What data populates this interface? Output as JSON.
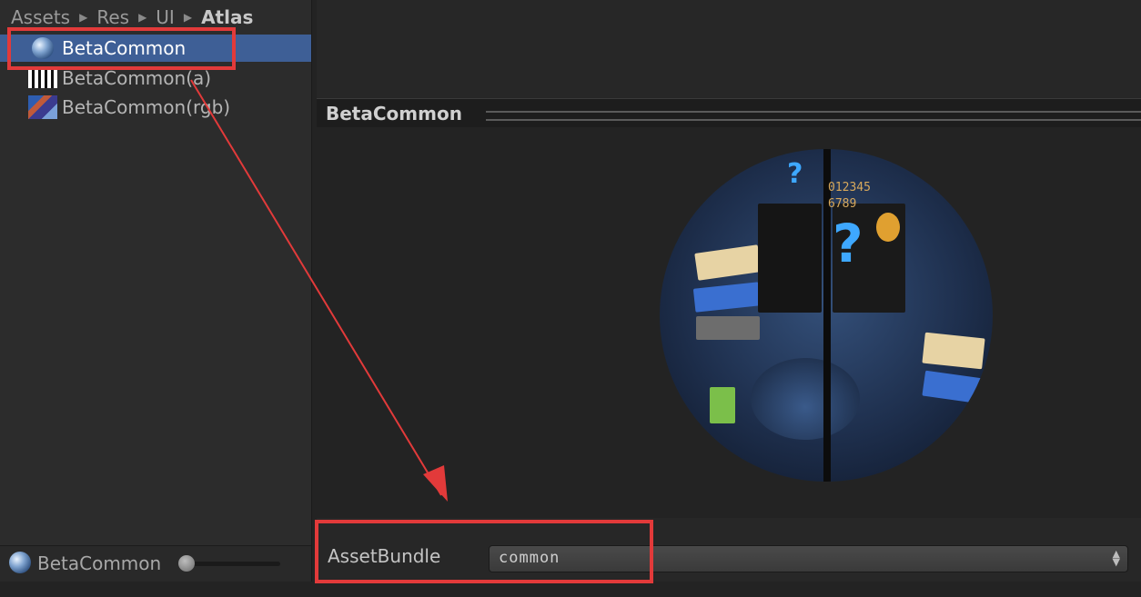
{
  "breadcrumb": [
    "Assets",
    "Res",
    "UI",
    "Atlas"
  ],
  "tree": {
    "items": [
      {
        "label": "BetaCommon",
        "icon": "material-sphere-icon",
        "selected": true
      },
      {
        "label": "BetaCommon(a)",
        "icon": "texture-alpha-icon",
        "selected": false
      },
      {
        "label": "BetaCommon(rgb)",
        "icon": "texture-rgb-icon",
        "selected": false
      }
    ]
  },
  "status": {
    "label": "BetaCommon"
  },
  "preview": {
    "title": "BetaCommon",
    "sphere_digits_line1": "012345",
    "sphere_digits_line2": "6789",
    "sphere_qmark": "?"
  },
  "asset_bundle": {
    "label": "AssetBundle",
    "value": "common"
  },
  "colors": {
    "selection": "#3e5f96",
    "annotation": "#e23a3a",
    "panel": "#2c2c2c"
  }
}
